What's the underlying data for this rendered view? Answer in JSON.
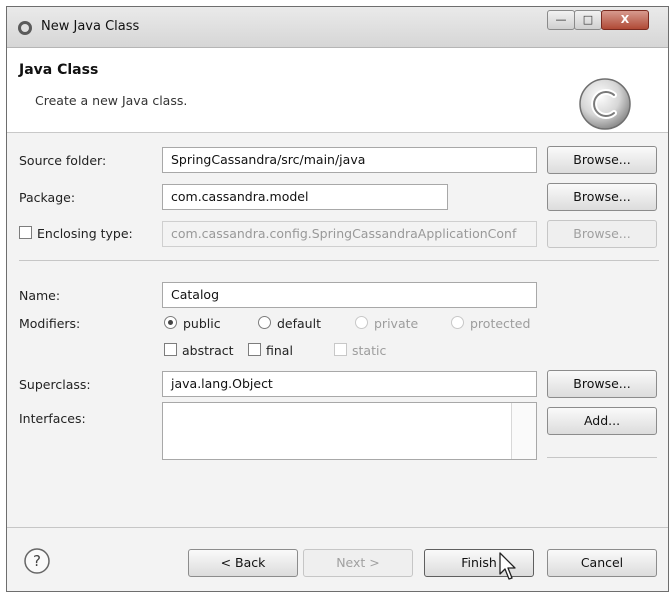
{
  "window": {
    "title": "New Java Class",
    "controls": {
      "minimize": "—",
      "maximize": "□",
      "close": "X"
    }
  },
  "header": {
    "title": "Java Class",
    "description": "Create a new Java class."
  },
  "fields": {
    "source_folder": {
      "label": "Source folder:",
      "value": "SpringCassandra/src/main/java",
      "button": "Browse..."
    },
    "package": {
      "label": "Package:",
      "value": "com.cassandra.model",
      "button": "Browse..."
    },
    "enclosing_type": {
      "label": "Enclosing type:",
      "value": "com.cassandra.config.SpringCassandraApplicationConf",
      "button": "Browse..."
    },
    "name": {
      "label": "Name:",
      "value": "Catalog"
    },
    "superclass": {
      "label": "Superclass:",
      "value": "java.lang.Object",
      "button": "Browse..."
    },
    "interfaces": {
      "label": "Interfaces:",
      "button": "Add..."
    }
  },
  "modifiers": {
    "label": "Modifiers:",
    "access": [
      "public",
      "default",
      "private",
      "protected"
    ],
    "selected": "public",
    "flags": [
      "abstract",
      "final",
      "static"
    ]
  },
  "footer": {
    "help_icon": "?",
    "back": "< Back",
    "next": "Next >",
    "finish": "Finish",
    "cancel": "Cancel"
  }
}
